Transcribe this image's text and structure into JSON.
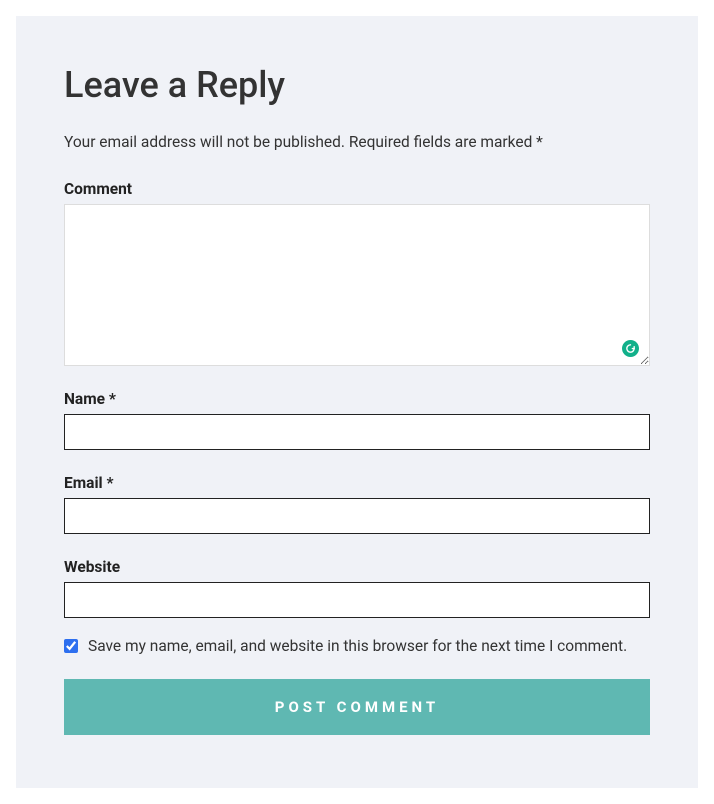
{
  "form": {
    "title": "Leave a Reply",
    "note": "Your email address will not be published. Required fields are marked *",
    "comment": {
      "label": "Comment",
      "value": ""
    },
    "name": {
      "label": "Name *",
      "value": ""
    },
    "email": {
      "label": "Email *",
      "value": ""
    },
    "website": {
      "label": "Website",
      "value": ""
    },
    "consent": {
      "checked": true,
      "label": "Save my name, email, and website in this browser for the next time I comment."
    },
    "submit_label": "Post Comment"
  },
  "colors": {
    "panel_bg": "#f0f2f7",
    "accent": "#5fb8b2",
    "checkbox_accent": "#2d6fef",
    "grammarly": "#11b08a"
  }
}
